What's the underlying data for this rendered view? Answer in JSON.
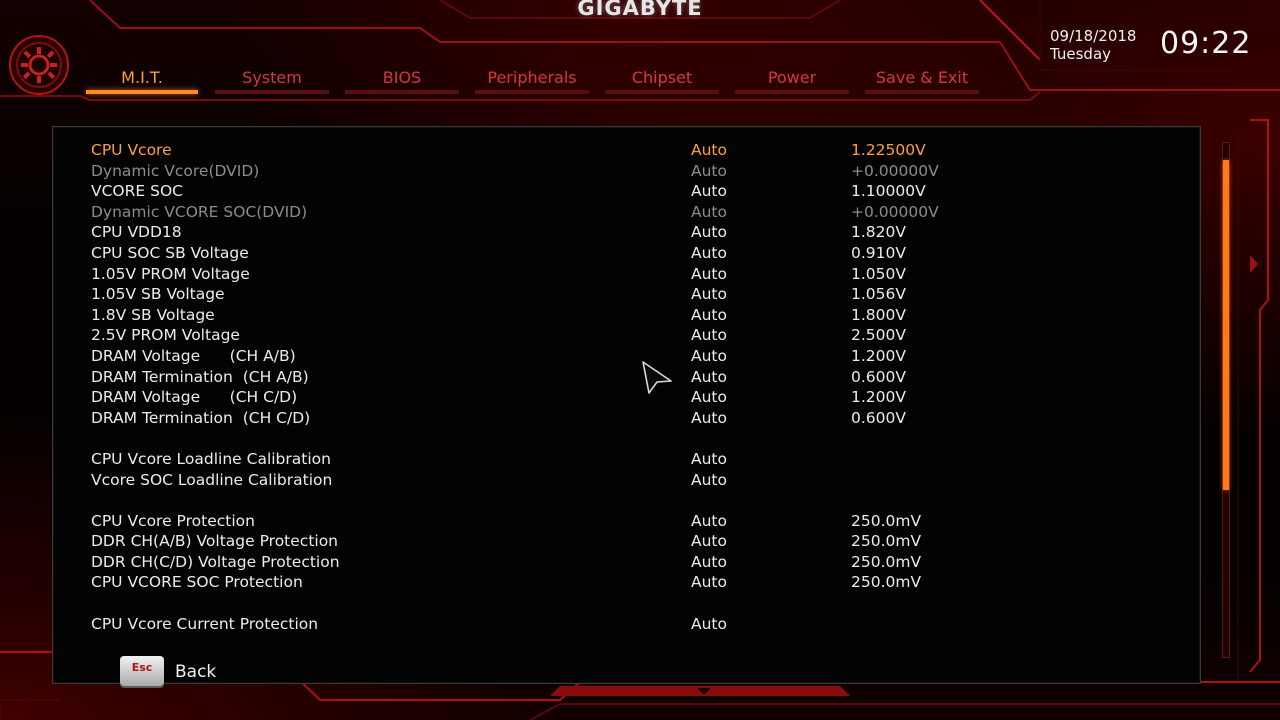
{
  "brand": "GIGABYTE",
  "tabs": [
    {
      "label": "M.I.T.",
      "active": true
    },
    {
      "label": "System",
      "active": false
    },
    {
      "label": "BIOS",
      "active": false
    },
    {
      "label": "Peripherals",
      "active": false
    },
    {
      "label": "Chipset",
      "active": false
    },
    {
      "label": "Power",
      "active": false
    },
    {
      "label": "Save & Exit",
      "active": false
    }
  ],
  "datetime": {
    "date": "09/18/2018",
    "day": "Tuesday",
    "time": "09:22"
  },
  "settings": [
    {
      "name": "CPU Vcore",
      "option": "Auto",
      "value": "1.22500V",
      "state": "selected"
    },
    {
      "name": "Dynamic Vcore(DVID)",
      "option": "Auto",
      "value": "+0.00000V",
      "state": "dim"
    },
    {
      "name": "VCORE SOC",
      "option": "Auto",
      "value": "1.10000V",
      "state": "normal"
    },
    {
      "name": "Dynamic VCORE SOC(DVID)",
      "option": "Auto",
      "value": "+0.00000V",
      "state": "dim"
    },
    {
      "name": "CPU VDD18",
      "option": "Auto",
      "value": "1.820V",
      "state": "normal"
    },
    {
      "name": "CPU SOC SB Voltage",
      "option": "Auto",
      "value": "0.910V",
      "state": "normal"
    },
    {
      "name": "1.05V PROM Voltage",
      "option": "Auto",
      "value": "1.050V",
      "state": "normal"
    },
    {
      "name": "1.05V SB Voltage",
      "option": "Auto",
      "value": "1.056V",
      "state": "normal"
    },
    {
      "name": "1.8V SB Voltage",
      "option": "Auto",
      "value": "1.800V",
      "state": "normal"
    },
    {
      "name": "2.5V PROM Voltage",
      "option": "Auto",
      "value": "2.500V",
      "state": "normal"
    },
    {
      "name": "DRAM Voltage      (CH A/B)",
      "option": "Auto",
      "value": "1.200V",
      "state": "normal"
    },
    {
      "name": "DRAM Termination  (CH A/B)",
      "option": "Auto",
      "value": "0.600V",
      "state": "normal"
    },
    {
      "name": "DRAM Voltage      (CH C/D)",
      "option": "Auto",
      "value": "1.200V",
      "state": "normal"
    },
    {
      "name": "DRAM Termination  (CH C/D)",
      "option": "Auto",
      "value": "0.600V",
      "state": "normal"
    },
    {
      "name": "",
      "option": "",
      "value": "",
      "state": "gap"
    },
    {
      "name": "CPU Vcore Loadline Calibration",
      "option": "Auto",
      "value": "",
      "state": "normal"
    },
    {
      "name": "Vcore SOC Loadline Calibration",
      "option": "Auto",
      "value": "",
      "state": "normal"
    },
    {
      "name": "",
      "option": "",
      "value": "",
      "state": "gap"
    },
    {
      "name": "CPU Vcore Protection",
      "option": "Auto",
      "value": "250.0mV",
      "state": "normal"
    },
    {
      "name": "DDR CH(A/B) Voltage Protection",
      "option": "Auto",
      "value": "250.0mV",
      "state": "normal"
    },
    {
      "name": "DDR CH(C/D) Voltage Protection",
      "option": "Auto",
      "value": "250.0mV",
      "state": "normal"
    },
    {
      "name": "CPU VCORE SOC Protection",
      "option": "Auto",
      "value": "250.0mV",
      "state": "normal"
    },
    {
      "name": "",
      "option": "",
      "value": "",
      "state": "gap"
    },
    {
      "name": "CPU Vcore Current Protection",
      "option": "Auto",
      "value": "",
      "state": "normal"
    }
  ],
  "footer": {
    "esc_key": "Esc",
    "back_label": "Back"
  },
  "colors": {
    "accent": "#ff8c2a",
    "tab_inactive": "#d53a3a",
    "dim": "#8c8c8c",
    "frame_red": "#c41414"
  }
}
